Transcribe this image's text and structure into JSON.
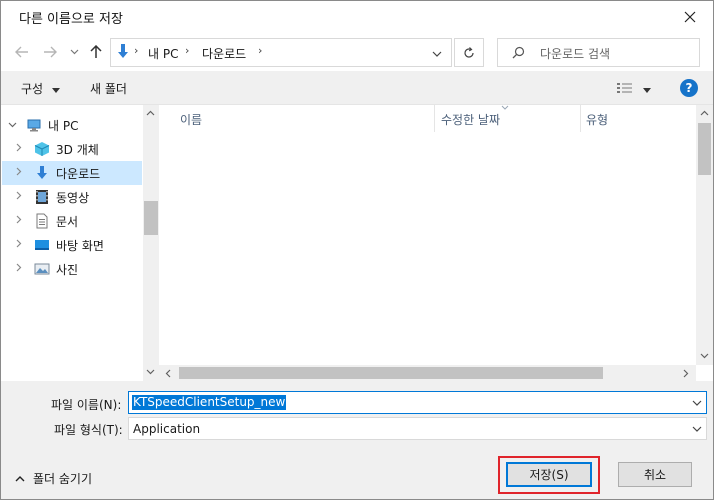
{
  "window": {
    "title": "다른 이름으로 저장"
  },
  "address": {
    "crumbs": [
      "내 PC",
      "다운로드"
    ]
  },
  "search": {
    "placeholder": "다운로드 검색"
  },
  "toolbar": {
    "organize": "구성",
    "new_folder": "새 폴더",
    "help": "?"
  },
  "nav": {
    "items": [
      {
        "label": "내 PC",
        "icon": "pc-icon",
        "expanded": true
      },
      {
        "label": "3D 개체",
        "icon": "cube-3d-icon"
      },
      {
        "label": "다운로드",
        "icon": "download-icon",
        "selected": true
      },
      {
        "label": "동영상",
        "icon": "video-icon"
      },
      {
        "label": "문서",
        "icon": "document-icon"
      },
      {
        "label": "바탕 화면",
        "icon": "desktop-icon"
      },
      {
        "label": "사진",
        "icon": "picture-icon"
      }
    ]
  },
  "columns": [
    "이름",
    "수정한 날짜",
    "유형"
  ],
  "form": {
    "filename_label": "파일 이름(N):",
    "filename_value": "KTSpeedClientSetup_new",
    "filetype_label": "파일 형식(T):",
    "filetype_value": "Application"
  },
  "footer": {
    "hide_folders": "폴더 숨기기",
    "save": "저장(S)",
    "cancel": "취소"
  },
  "colors": {
    "accent": "#0078d7",
    "selected_bg": "#cce8ff",
    "highlight_outline": "#e0242b"
  }
}
